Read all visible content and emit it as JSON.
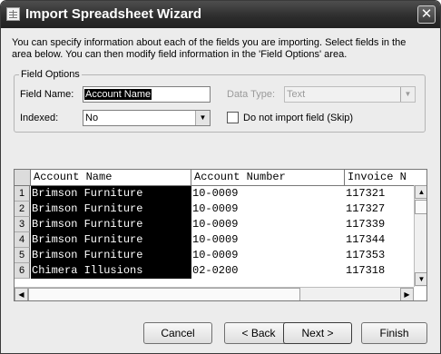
{
  "window": {
    "title": "Import Spreadsheet Wizard"
  },
  "intro": {
    "line1": "You can specify information about each of the fields you are importing.  Select fields in the",
    "line2": "area below. You can then modify field information in the 'Field Options' area."
  },
  "field_options": {
    "legend": "Field Options",
    "field_name_label": "Field Name:",
    "field_name_value": "Account Name",
    "data_type_label": "Data Type:",
    "data_type_value": "Text",
    "indexed_label": "Indexed:",
    "indexed_value": "No",
    "skip_label": "Do not import field (Skip)",
    "skip_checked": false
  },
  "grid": {
    "columns": [
      "Account Name",
      "Account Number",
      "Invoice N"
    ],
    "rows": [
      {
        "n": "1",
        "cells": [
          "Brimson Furniture",
          "10-0009",
          "117321"
        ]
      },
      {
        "n": "2",
        "cells": [
          "Brimson Furniture",
          "10-0009",
          "117327"
        ]
      },
      {
        "n": "3",
        "cells": [
          "Brimson Furniture",
          "10-0009",
          "117339"
        ]
      },
      {
        "n": "4",
        "cells": [
          "Brimson Furniture",
          "10-0009",
          "117344"
        ]
      },
      {
        "n": "5",
        "cells": [
          "Brimson Furniture",
          "10-0009",
          "117353"
        ]
      },
      {
        "n": "6",
        "cells": [
          "Chimera Illusions",
          "02-0200",
          "117318"
        ]
      }
    ],
    "selected_column": "Account Name"
  },
  "buttons": {
    "cancel": "Cancel",
    "back": "< Back",
    "next": "Next >",
    "finish": "Finish"
  },
  "icons": {
    "app": "spreadsheet-icon",
    "close": "close-icon",
    "dropdown": "chevron-down-icon",
    "scroll_up": "arrow-up-icon",
    "scroll_down": "arrow-down-icon",
    "scroll_left": "arrow-left-icon",
    "scroll_right": "arrow-right-icon"
  }
}
